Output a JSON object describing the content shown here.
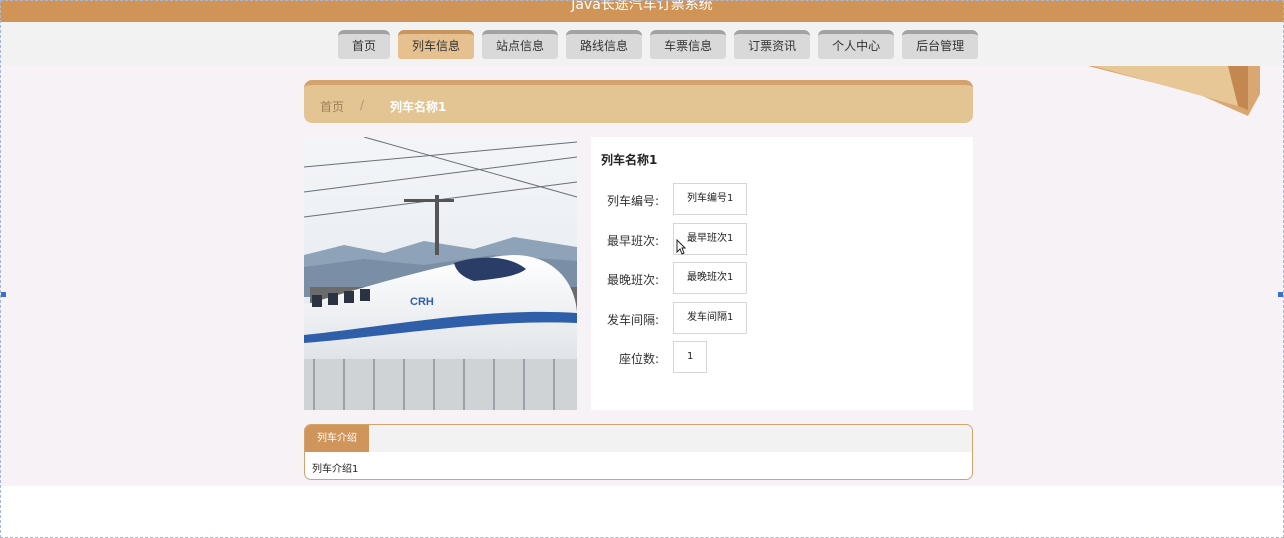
{
  "app": {
    "title": "Java长途汽车订票系统"
  },
  "nav": {
    "items": [
      "首页",
      "列车信息",
      "站点信息",
      "路线信息",
      "车票信息",
      "订票资讯",
      "个人中心",
      "后台管理"
    ],
    "active_index": 1
  },
  "breadcrumb": {
    "home": "首页",
    "separator": "/",
    "current": "列车名称1"
  },
  "detail": {
    "title": "列车名称1",
    "fields": [
      {
        "label": "列车编号:",
        "value": "列车编号1"
      },
      {
        "label": "最早班次:",
        "value": "最早班次1"
      },
      {
        "label": "最晚班次:",
        "value": "最晚班次1"
      },
      {
        "label": "发车间隔:",
        "value": "发车间隔1"
      },
      {
        "label": "座位数:",
        "value": "1"
      }
    ]
  },
  "intro": {
    "tab_label": "列车介绍",
    "content": "列车介绍1"
  },
  "colors": {
    "header": "#d09457",
    "nav_active": "#e6c08f",
    "breadcrumb_bg": "#e3c493",
    "accent": "#d0955a"
  }
}
